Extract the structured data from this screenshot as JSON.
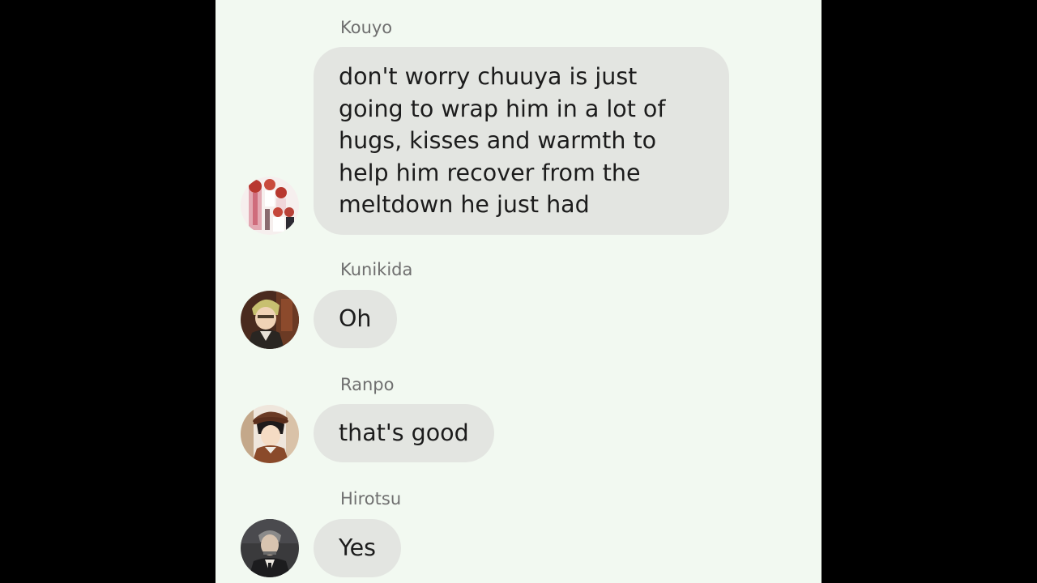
{
  "messages": [
    {
      "sender": "Kouyo",
      "text_lines": [
        "don't worry chuuya is just",
        "going to wrap him in a lot of",
        "hugs, kisses and warmth to",
        "help him recover from the",
        "meltdown he just had"
      ],
      "avatar_icon": "kouyo-avatar"
    },
    {
      "sender": "Kunikida",
      "text_lines": [
        "Oh"
      ],
      "avatar_icon": "kunikida-avatar"
    },
    {
      "sender": "Ranpo",
      "text_lines": [
        "that's good"
      ],
      "avatar_icon": "ranpo-avatar"
    },
    {
      "sender": "Hirotsu",
      "text_lines": [
        "Yes"
      ],
      "avatar_icon": "hirotsu-avatar"
    }
  ],
  "colors": {
    "background": "#000000",
    "panel": "#f2f9f1",
    "bubble": "#e3e5e1",
    "text": "#1c1c1c",
    "sender_name": "#6f6f6f"
  }
}
